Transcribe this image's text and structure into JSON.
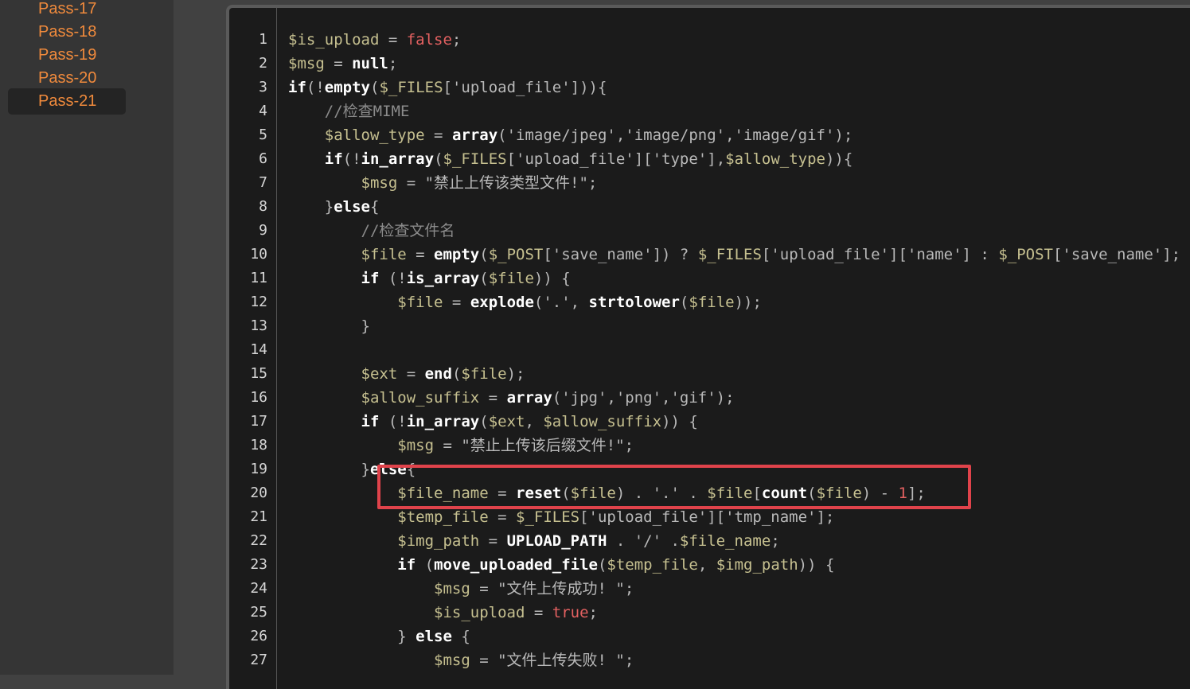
{
  "sidebar": {
    "items": [
      {
        "label": "Pass-17",
        "active": false
      },
      {
        "label": "Pass-18",
        "active": false
      },
      {
        "label": "Pass-19",
        "active": false
      },
      {
        "label": "Pass-20",
        "active": false
      },
      {
        "label": "Pass-21",
        "active": true
      }
    ]
  },
  "colors": {
    "accent": "#f08a3c",
    "highlight": "#e0434b",
    "panel_bg": "#1b1b1b"
  },
  "code": {
    "line_numbers": [
      "1",
      "2",
      "3",
      "4",
      "5",
      "6",
      "7",
      "8",
      "9",
      "10",
      "11",
      "12",
      "13",
      "14",
      "15",
      "16",
      "17",
      "18",
      "19",
      "20",
      "21",
      "22",
      "23",
      "24",
      "25",
      "26",
      "27"
    ],
    "lines": [
      [
        [
          "v",
          "$is_upload"
        ],
        [
          "p",
          " = "
        ],
        [
          "b",
          "false"
        ],
        [
          "p",
          ";"
        ]
      ],
      [
        [
          "v",
          "$msg"
        ],
        [
          "p",
          " = "
        ],
        [
          "k",
          "null"
        ],
        [
          "p",
          ";"
        ]
      ],
      [
        [
          "kw",
          "if"
        ],
        [
          "p",
          "(!"
        ],
        [
          "fn",
          "empty"
        ],
        [
          "p",
          "("
        ],
        [
          "v",
          "$_FILES"
        ],
        [
          "p",
          "['upload_file'])){"
        ]
      ],
      [
        [
          "p",
          "    "
        ],
        [
          "c",
          "//检查MIME"
        ]
      ],
      [
        [
          "p",
          "    "
        ],
        [
          "v",
          "$allow_type"
        ],
        [
          "p",
          " = "
        ],
        [
          "fn",
          "array"
        ],
        [
          "p",
          "('image/jpeg','image/png','image/gif');"
        ]
      ],
      [
        [
          "p",
          "    "
        ],
        [
          "kw",
          "if"
        ],
        [
          "p",
          "(!"
        ],
        [
          "fn",
          "in_array"
        ],
        [
          "p",
          "("
        ],
        [
          "v",
          "$_FILES"
        ],
        [
          "p",
          "['upload_file']['type'],"
        ],
        [
          "v",
          "$allow_type"
        ],
        [
          "p",
          "))"
        ],
        [
          "p",
          "{"
        ]
      ],
      [
        [
          "p",
          "        "
        ],
        [
          "v",
          "$msg"
        ],
        [
          "p",
          " = \"禁止上传该类型文件!\";"
        ]
      ],
      [
        [
          "p",
          "    }"
        ],
        [
          "kw",
          "else"
        ],
        [
          "p",
          "{"
        ]
      ],
      [
        [
          "p",
          "        "
        ],
        [
          "c",
          "//检查文件名"
        ]
      ],
      [
        [
          "p",
          "        "
        ],
        [
          "v",
          "$file"
        ],
        [
          "p",
          " = "
        ],
        [
          "fn",
          "empty"
        ],
        [
          "p",
          "("
        ],
        [
          "v",
          "$_POST"
        ],
        [
          "p",
          "['save_name']) ? "
        ],
        [
          "v",
          "$_FILES"
        ],
        [
          "p",
          "['upload_file']['name'] : "
        ],
        [
          "v",
          "$_POST"
        ],
        [
          "p",
          "['save_name'];"
        ]
      ],
      [
        [
          "p",
          "        "
        ],
        [
          "kw",
          "if"
        ],
        [
          "p",
          " (!"
        ],
        [
          "fn",
          "is_array"
        ],
        [
          "p",
          "("
        ],
        [
          "v",
          "$file"
        ],
        [
          "p",
          ")) {"
        ]
      ],
      [
        [
          "p",
          "            "
        ],
        [
          "v",
          "$file"
        ],
        [
          "p",
          " = "
        ],
        [
          "fn",
          "explode"
        ],
        [
          "p",
          "('.', "
        ],
        [
          "fn",
          "strtolower"
        ],
        [
          "p",
          "("
        ],
        [
          "v",
          "$file"
        ],
        [
          "p",
          "));"
        ]
      ],
      [
        [
          "p",
          "        }"
        ]
      ],
      [
        [
          "p",
          ""
        ]
      ],
      [
        [
          "p",
          "        "
        ],
        [
          "v",
          "$ext"
        ],
        [
          "p",
          " = "
        ],
        [
          "fn",
          "end"
        ],
        [
          "p",
          "("
        ],
        [
          "v",
          "$file"
        ],
        [
          "p",
          ");"
        ]
      ],
      [
        [
          "p",
          "        "
        ],
        [
          "v",
          "$allow_suffix"
        ],
        [
          "p",
          " = "
        ],
        [
          "fn",
          "array"
        ],
        [
          "p",
          "('jpg','png','gif');"
        ]
      ],
      [
        [
          "p",
          "        "
        ],
        [
          "kw",
          "if"
        ],
        [
          "p",
          " (!"
        ],
        [
          "fn",
          "in_array"
        ],
        [
          "p",
          "("
        ],
        [
          "v",
          "$ext"
        ],
        [
          "p",
          ", "
        ],
        [
          "v",
          "$allow_suffix"
        ],
        [
          "p",
          ")) {"
        ]
      ],
      [
        [
          "p",
          "            "
        ],
        [
          "v",
          "$msg"
        ],
        [
          "p",
          " = \"禁止上传该后缀文件!\";"
        ]
      ],
      [
        [
          "p",
          "        }"
        ],
        [
          "kw",
          "else"
        ],
        [
          "p",
          "{"
        ]
      ],
      [
        [
          "p",
          "            "
        ],
        [
          "v",
          "$file_name"
        ],
        [
          "p",
          " = "
        ],
        [
          "fn",
          "reset"
        ],
        [
          "p",
          "("
        ],
        [
          "v",
          "$file"
        ],
        [
          "p",
          ") . '.' . "
        ],
        [
          "v",
          "$file"
        ],
        [
          "p",
          "["
        ],
        [
          "fn",
          "count"
        ],
        [
          "p",
          "("
        ],
        [
          "v",
          "$file"
        ],
        [
          "p",
          ") - "
        ],
        [
          "b",
          "1"
        ],
        [
          "p",
          "];"
        ]
      ],
      [
        [
          "p",
          "            "
        ],
        [
          "v",
          "$temp_file"
        ],
        [
          "p",
          " = "
        ],
        [
          "v",
          "$_FILES"
        ],
        [
          "p",
          "['upload_file']['tmp_name'];"
        ]
      ],
      [
        [
          "p",
          "            "
        ],
        [
          "v",
          "$img_path"
        ],
        [
          "p",
          " = "
        ],
        [
          "fn",
          "UPLOAD_PATH"
        ],
        [
          "p",
          " . '/' ."
        ],
        [
          "v",
          "$file_name"
        ],
        [
          "p",
          ";"
        ]
      ],
      [
        [
          "p",
          "            "
        ],
        [
          "kw",
          "if"
        ],
        [
          "p",
          " ("
        ],
        [
          "fn",
          "move_uploaded_file"
        ],
        [
          "p",
          "("
        ],
        [
          "v",
          "$temp_file"
        ],
        [
          "p",
          ", "
        ],
        [
          "v",
          "$img_path"
        ],
        [
          "p",
          ")) {"
        ]
      ],
      [
        [
          "p",
          "                "
        ],
        [
          "v",
          "$msg"
        ],
        [
          "p",
          " = \"文件上传成功! \";"
        ]
      ],
      [
        [
          "p",
          "                "
        ],
        [
          "v",
          "$is_upload"
        ],
        [
          "p",
          " = "
        ],
        [
          "b",
          "true"
        ],
        [
          "p",
          ";"
        ]
      ],
      [
        [
          "p",
          "            } "
        ],
        [
          "kw",
          "else"
        ],
        [
          "p",
          " {"
        ]
      ],
      [
        [
          "p",
          "                "
        ],
        [
          "v",
          "$msg"
        ],
        [
          "p",
          " = \"文件上传失败! \";"
        ]
      ]
    ]
  }
}
